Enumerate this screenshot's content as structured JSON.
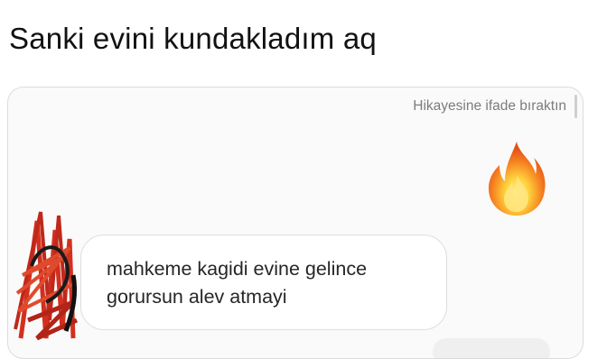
{
  "post": {
    "caption": "Sanki evini kundakladım aq"
  },
  "chat": {
    "story_reaction_label": "Hikayesine ifade bıraktın",
    "reaction_emoji_icon": "fire-icon",
    "incoming_message": {
      "line1": "mahkeme kagidi evine gelince",
      "line2": "gorursun alev atmayi"
    },
    "avatar_icon": "scribbled-avatar-icon"
  },
  "colors": {
    "fire_orange": "#f57c1f",
    "fire_yellow": "#ffd23c",
    "scribble_red": "#d2301f",
    "label_gray": "#7c7c7c"
  }
}
